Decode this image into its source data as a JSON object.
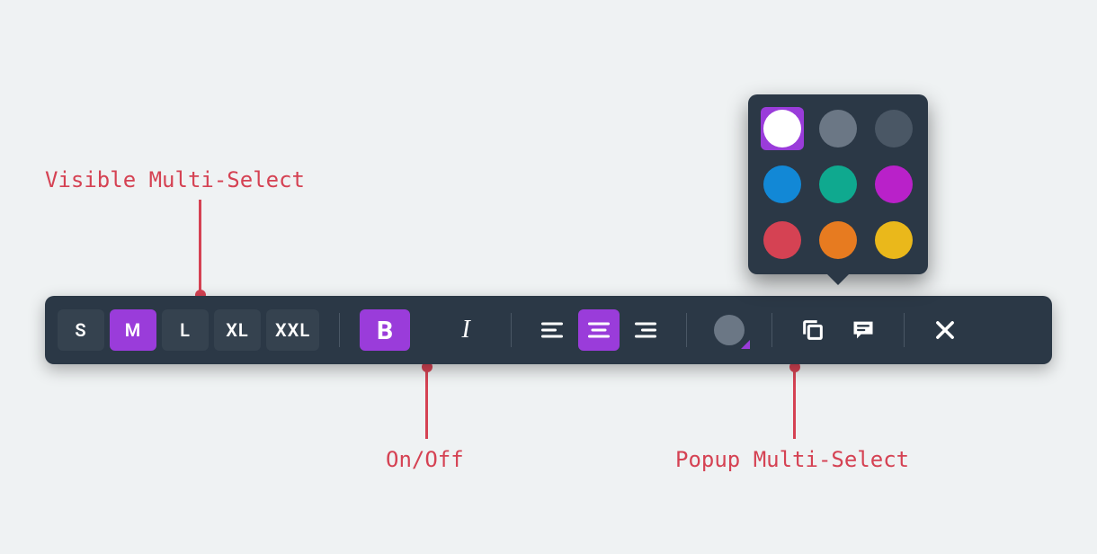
{
  "annotations": {
    "visible_multi_select": "Visible Multi-Select",
    "on_off": "On/Off",
    "popup_multi_select": "Popup Multi-Select"
  },
  "colors": {
    "accent": "#9a3cda",
    "annotation": "#d54253",
    "toolbar_bg": "#2b3846",
    "page_bg": "#eff2f3"
  },
  "toolbar": {
    "sizes": {
      "options": [
        {
          "label": "S",
          "selected": false
        },
        {
          "label": "M",
          "selected": true
        },
        {
          "label": "L",
          "selected": false
        },
        {
          "label": "XL",
          "selected": false
        },
        {
          "label": "XXL",
          "selected": false
        }
      ]
    },
    "bold": {
      "label": "B",
      "on": true
    },
    "italic": {
      "label": "I",
      "on": false
    },
    "align": {
      "options": [
        {
          "value": "left",
          "selected": false
        },
        {
          "value": "center",
          "selected": true
        },
        {
          "value": "right",
          "selected": false
        }
      ]
    },
    "color_swatch": {
      "current": "#6b7785",
      "has_popup_indicator": true
    },
    "actions": {
      "copy": "copy",
      "comment": "comment",
      "close": "close"
    }
  },
  "popup": {
    "colors": [
      {
        "value": "#ffffff",
        "selected": true
      },
      {
        "value": "#6b7785",
        "selected": false
      },
      {
        "value": "#4a5765",
        "selected": false
      },
      {
        "value": "#1288d6",
        "selected": false
      },
      {
        "value": "#0fa98f",
        "selected": false
      },
      {
        "value": "#b921c9",
        "selected": false
      },
      {
        "value": "#d54253",
        "selected": false
      },
      {
        "value": "#e77b20",
        "selected": false
      },
      {
        "value": "#eab81b",
        "selected": false
      }
    ]
  }
}
